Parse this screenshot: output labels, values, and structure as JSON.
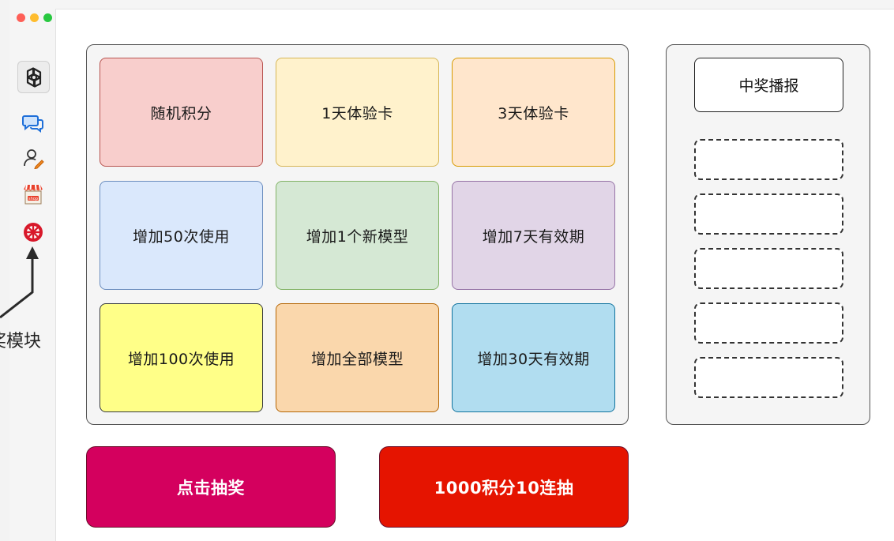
{
  "annotation": {
    "label": "奖模块"
  },
  "grid": {
    "cells": [
      {
        "label": "随机积分",
        "fill": "#f8cecc",
        "border": "#b85450"
      },
      {
        "label": "1天体验卡",
        "fill": "#fff2cc",
        "border": "#d6b656"
      },
      {
        "label": "3天体验卡",
        "fill": "#ffe6cc",
        "border": "#d79b00"
      },
      {
        "label": "增加50次使用",
        "fill": "#dae8fc",
        "border": "#6c8ebf"
      },
      {
        "label": "增加1个新模型",
        "fill": "#d5e8d4",
        "border": "#82b366"
      },
      {
        "label": "增加7天有效期",
        "fill": "#e1d5e7",
        "border": "#9673a6"
      },
      {
        "label": "增加100次使用",
        "fill": "#ffff88",
        "border": "#36393d"
      },
      {
        "label": "增加全部模型",
        "fill": "#fad7ac",
        "border": "#b46504"
      },
      {
        "label": "增加30天有效期",
        "fill": "#b1ddf0",
        "border": "#10739e"
      }
    ]
  },
  "broadcast": {
    "title": "中奖播报",
    "slot_count": 5
  },
  "buttons": {
    "draw": {
      "label": "点击抽奖",
      "color": "#d4005e"
    },
    "ten_draw": {
      "label": "1000积分10连抽",
      "color": "#e51400"
    }
  },
  "sidebar": {
    "icons": [
      "openai-logo-icon",
      "chat-icon",
      "user-icon",
      "shop-icon",
      "lottery-wheel-icon"
    ]
  }
}
